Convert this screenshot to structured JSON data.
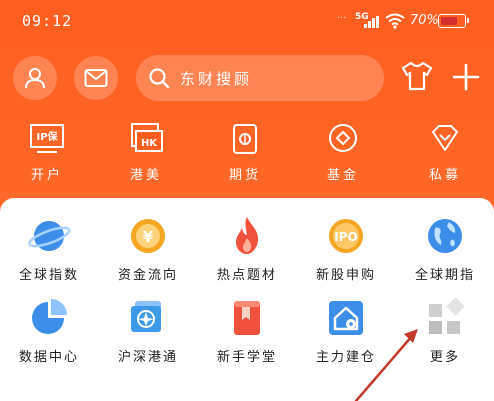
{
  "status_bar": {
    "time": "09:12",
    "network": "5G",
    "battery_percent": "70%"
  },
  "search": {
    "placeholder": "东财搜顾"
  },
  "header_nav": [
    {
      "id": "open-account",
      "label": "开户",
      "icon": "ipo-badge-icon"
    },
    {
      "id": "hk-us",
      "label": "港美",
      "icon": "hk-us-icon"
    },
    {
      "id": "futures",
      "label": "期货",
      "icon": "futures-icon"
    },
    {
      "id": "funds",
      "label": "基金",
      "icon": "fund-icon"
    },
    {
      "id": "private",
      "label": "私募",
      "icon": "gem-icon"
    }
  ],
  "menu_grid": [
    {
      "id": "global-index",
      "label": "全球指数",
      "icon": "planet-icon"
    },
    {
      "id": "capital-flow",
      "label": "资金流向",
      "icon": "coin-icon"
    },
    {
      "id": "hot-topics",
      "label": "热点题材",
      "icon": "flame-icon"
    },
    {
      "id": "new-ipo",
      "label": "新股申购",
      "icon": "ipo-icon",
      "icon_text": "IPO"
    },
    {
      "id": "global-futures",
      "label": "全球期指",
      "icon": "globe-icon"
    },
    {
      "id": "data-center",
      "label": "数据中心",
      "icon": "pie-chart-icon"
    },
    {
      "id": "connect",
      "label": "沪深港通",
      "icon": "hk-flag-icon"
    },
    {
      "id": "beginner",
      "label": "新手学堂",
      "icon": "bookmark-book-icon"
    },
    {
      "id": "main-force",
      "label": "主力建仓",
      "icon": "house-icon"
    },
    {
      "id": "more",
      "label": "更多",
      "icon": "more-grid-icon"
    }
  ],
  "colors": {
    "brand": "#ff5e1f",
    "panel": "#ffffff",
    "arrow": "#c0392b"
  }
}
